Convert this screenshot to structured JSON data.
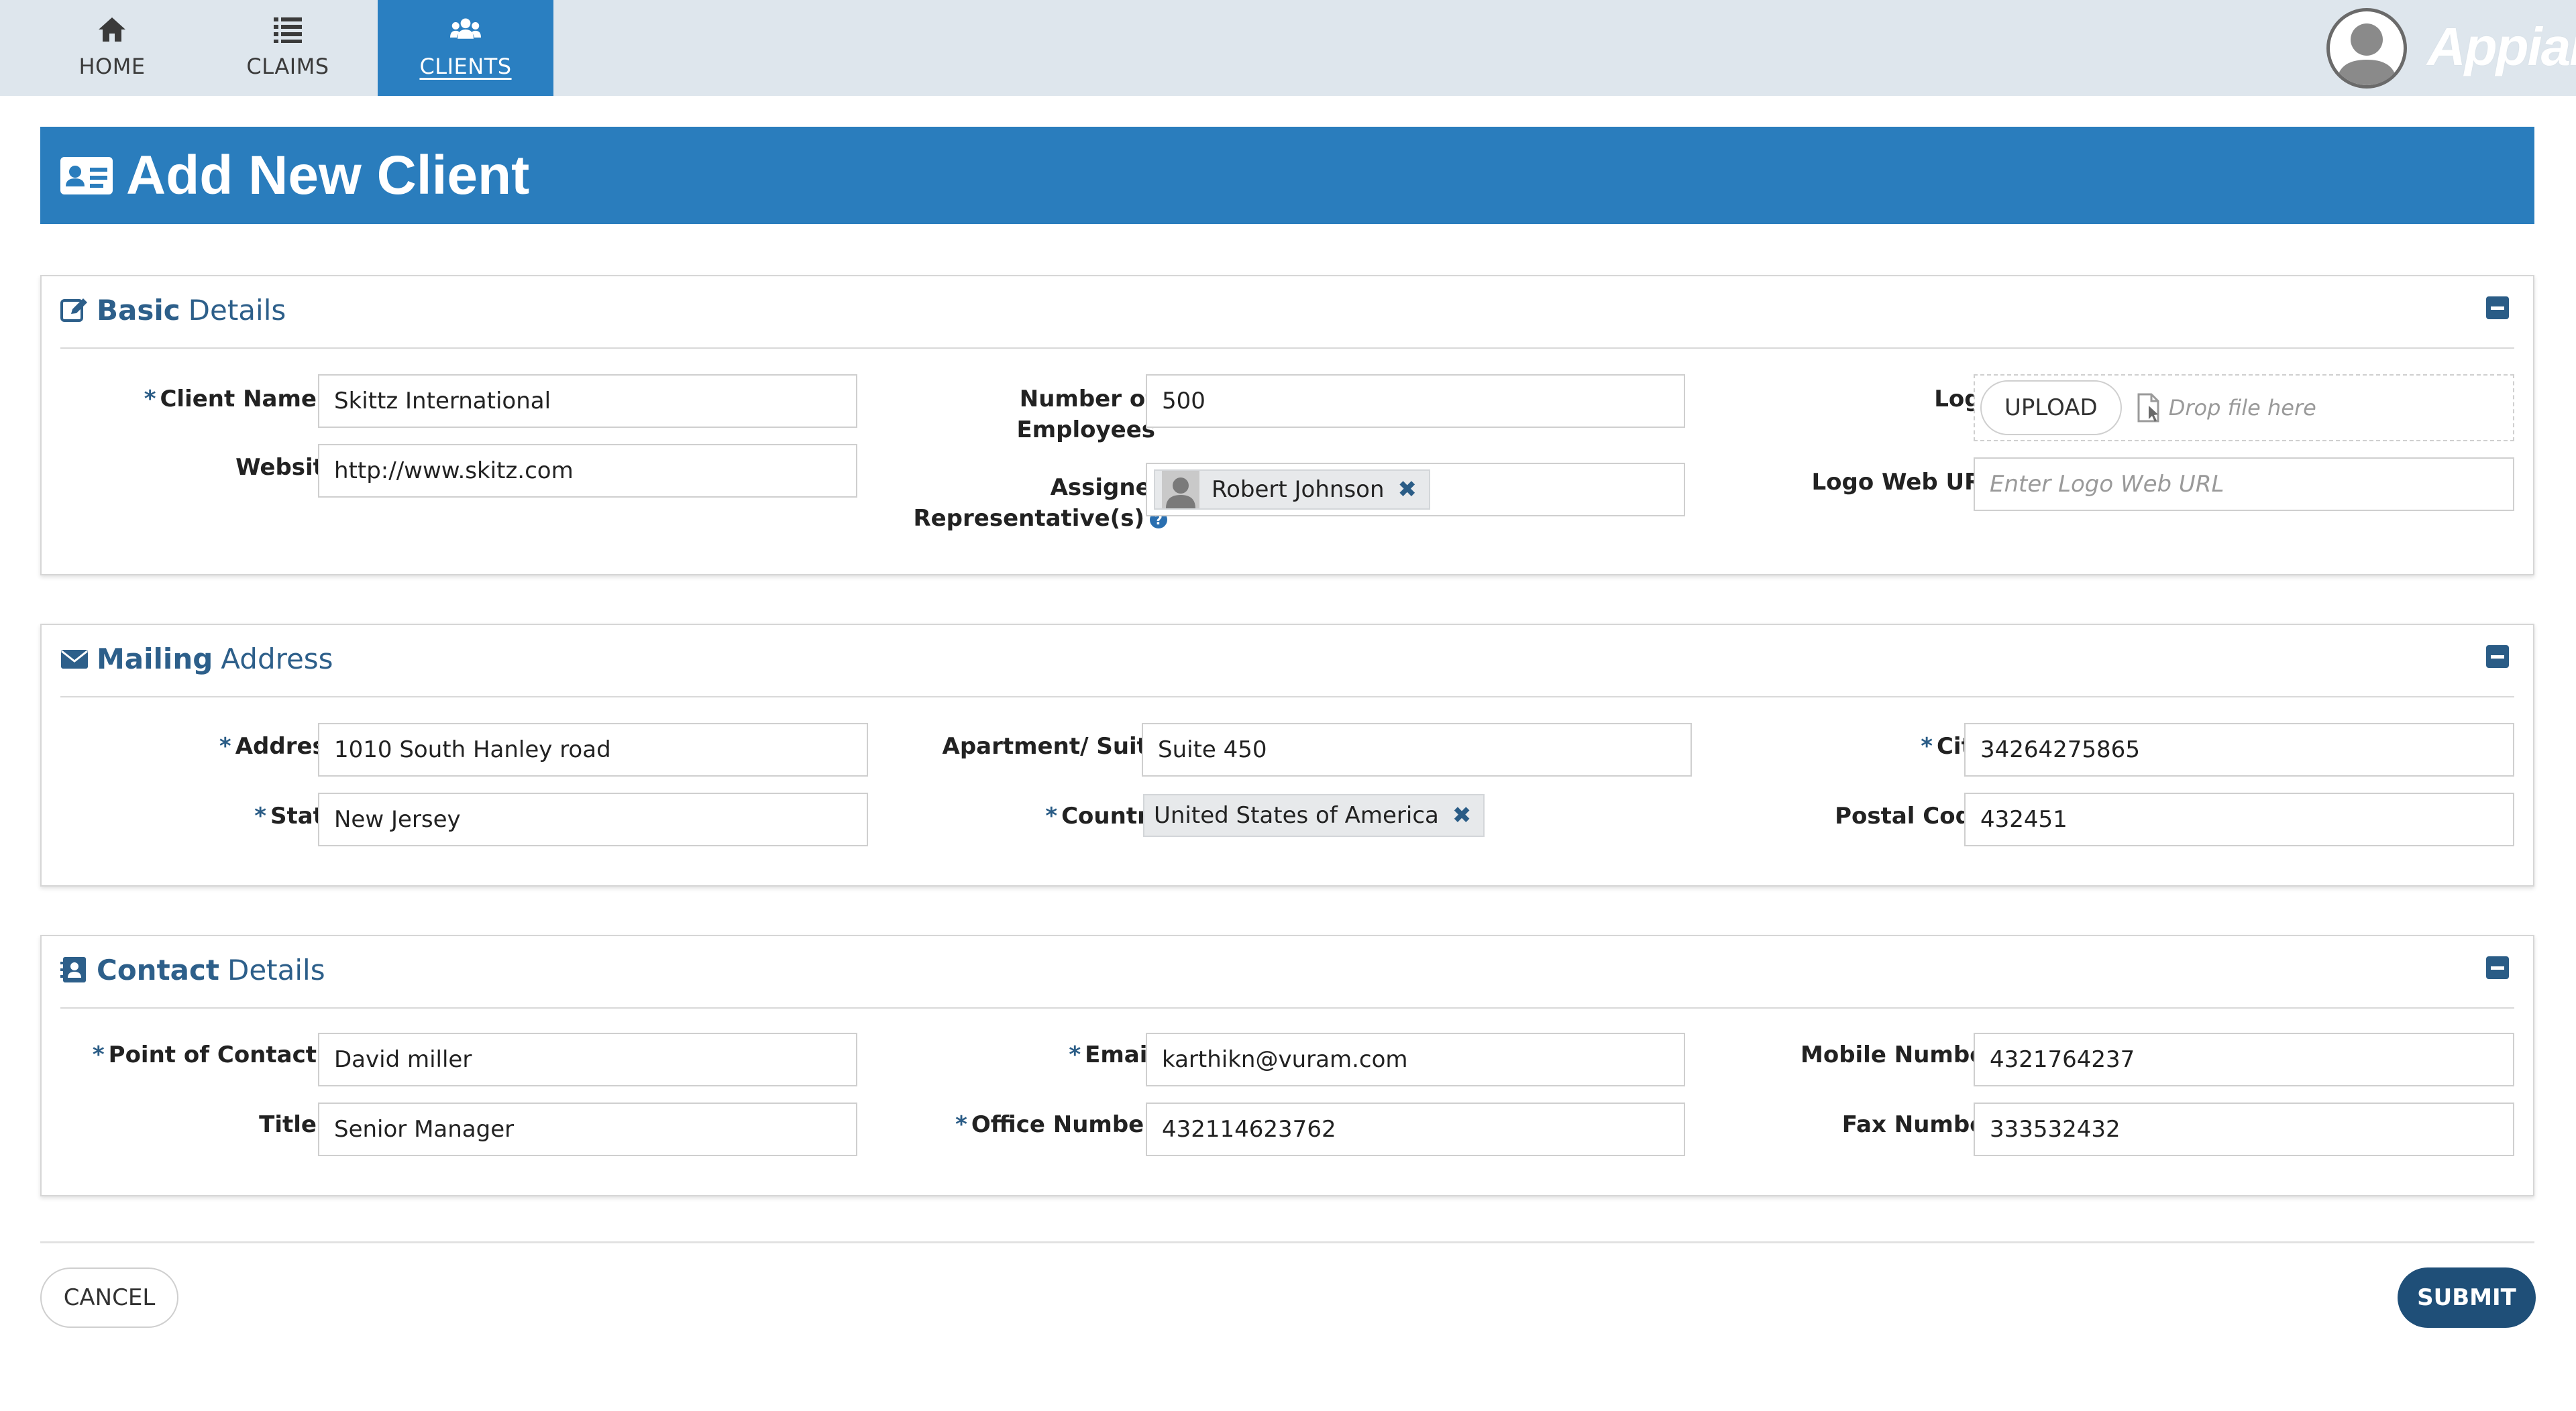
{
  "nav": {
    "tabs": [
      {
        "label": "HOME",
        "icon": "home-icon"
      },
      {
        "label": "CLAIMS",
        "icon": "list-icon"
      },
      {
        "label": "CLIENTS",
        "icon": "users-icon",
        "active": true
      }
    ],
    "brand": "Appian"
  },
  "page": {
    "title": "Add New Client"
  },
  "basic": {
    "title_bold": "Basic",
    "title_rest": "Details",
    "client_name_label": "Client Name",
    "client_name_value": "Skittz International",
    "website_label": "Website",
    "website_value": "http://www.skitz.com",
    "employees_label_1": "Number of",
    "employees_label_2": "Employees",
    "employees_value": "500",
    "rep_label_1": "Assigned",
    "rep_label_2": "Representative(s)",
    "rep_value": "Robert Johnson",
    "logo_label": "Logo",
    "upload_label": "UPLOAD",
    "drop_text": "Drop file here",
    "logo_url_label": "Logo Web URL",
    "logo_url_placeholder": "Enter Logo Web URL"
  },
  "mailing": {
    "title_bold": "Mailing",
    "title_rest": "Address",
    "address_label": "Address",
    "address_value": "1010 South Hanley road",
    "state_label": "State",
    "state_value": "New Jersey",
    "apt_label": "Apartment/ Suite",
    "apt_value": "Suite 450",
    "country_label": "Country",
    "country_value": "United States of America",
    "city_label": "City",
    "city_value": "34264275865",
    "postal_label": "Postal Code",
    "postal_value": "432451"
  },
  "contact": {
    "title_bold": "Contact",
    "title_rest": "Details",
    "poc_label": "Point of Contact",
    "poc_value": "David miller",
    "title_label": "Title",
    "title_value": "Senior Manager",
    "email_label": "Email",
    "email_value": "karthikn@vuram.com",
    "office_label": "Office Number",
    "office_value": "432114623762",
    "mobile_label": "Mobile Number",
    "mobile_value": "4321764237",
    "fax_label": "Fax Number",
    "fax_value": "333532432"
  },
  "footer": {
    "cancel_label": "CANCEL",
    "submit_label": "SUBMIT"
  },
  "colors": {
    "accent": "#2a7dbd",
    "dark_accent": "#1f4f78",
    "nav_bg": "#dee6ed"
  }
}
